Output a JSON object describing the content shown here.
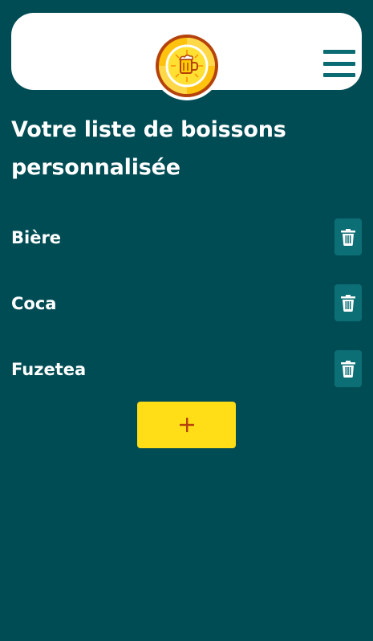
{
  "header": {
    "logo_icon": "beer-mug-coin-icon",
    "menu_icon": "hamburger-menu-icon"
  },
  "page": {
    "title": "Votre liste de boissons personnalisée"
  },
  "drinks": [
    {
      "name": "Bière",
      "action_icon": "trash-icon"
    },
    {
      "name": "Coca",
      "action_icon": "trash-icon"
    },
    {
      "name": "Fuzetea",
      "action_icon": "trash-icon"
    }
  ],
  "add_button": {
    "icon": "plus-icon"
  },
  "colors": {
    "background": "#004c54",
    "header_bg": "#ffffff",
    "menu_icon": "#0b6b72",
    "delete_bg": "#0d6f76",
    "add_bg": "#ffdd17",
    "add_icon": "#b5420c",
    "text": "#ffffff"
  }
}
